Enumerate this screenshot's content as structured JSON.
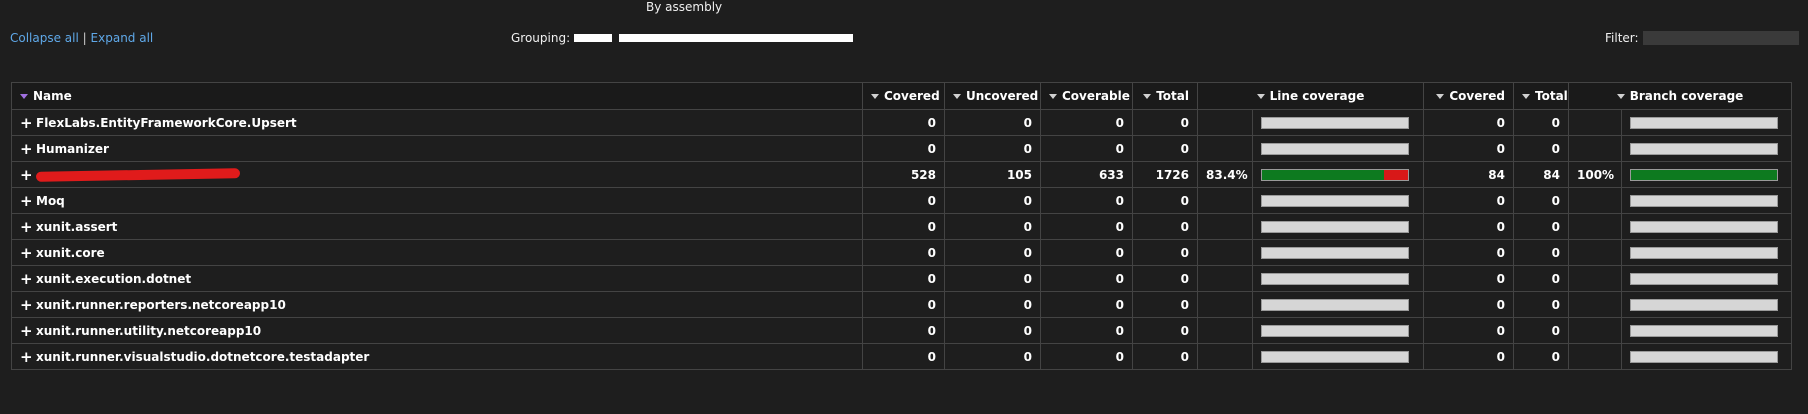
{
  "page_title": "By assembly",
  "toolbar": {
    "collapse_all": "Collapse all",
    "separator": "|",
    "expand_all": "Expand all",
    "grouping_label": "Grouping:",
    "filter_label": "Filter:",
    "filter_value": ""
  },
  "table": {
    "headers": {
      "name": "Name",
      "covered": "Covered",
      "uncovered": "Uncovered",
      "coverable": "Coverable",
      "total": "Total",
      "line_coverage": "Line coverage",
      "branch_covered": "Covered",
      "branch_total": "Total",
      "branch_coverage": "Branch coverage"
    },
    "rows": [
      {
        "name": "FlexLabs.EntityFrameworkCore.Upsert",
        "covered": "0",
        "uncovered": "0",
        "coverable": "0",
        "total": "0",
        "line_pct_text": "",
        "line_pct": null,
        "branch_covered": "0",
        "branch_total": "0",
        "branch_pct_text": "",
        "branch_pct": null
      },
      {
        "name": "Humanizer",
        "covered": "0",
        "uncovered": "0",
        "coverable": "0",
        "total": "0",
        "line_pct_text": "",
        "line_pct": null,
        "branch_covered": "0",
        "branch_total": "0",
        "branch_pct_text": "",
        "branch_pct": null
      },
      {
        "name": "",
        "redacted": true,
        "covered": "528",
        "uncovered": "105",
        "coverable": "633",
        "total": "1726",
        "line_pct_text": "83.4%",
        "line_pct": 83.4,
        "branch_covered": "84",
        "branch_total": "84",
        "branch_pct_text": "100%",
        "branch_pct": 100
      },
      {
        "name": "Moq",
        "covered": "0",
        "uncovered": "0",
        "coverable": "0",
        "total": "0",
        "line_pct_text": "",
        "line_pct": null,
        "branch_covered": "0",
        "branch_total": "0",
        "branch_pct_text": "",
        "branch_pct": null
      },
      {
        "name": "xunit.assert",
        "covered": "0",
        "uncovered": "0",
        "coverable": "0",
        "total": "0",
        "line_pct_text": "",
        "line_pct": null,
        "branch_covered": "0",
        "branch_total": "0",
        "branch_pct_text": "",
        "branch_pct": null
      },
      {
        "name": "xunit.core",
        "covered": "0",
        "uncovered": "0",
        "coverable": "0",
        "total": "0",
        "line_pct_text": "",
        "line_pct": null,
        "branch_covered": "0",
        "branch_total": "0",
        "branch_pct_text": "",
        "branch_pct": null
      },
      {
        "name": "xunit.execution.dotnet",
        "covered": "0",
        "uncovered": "0",
        "coverable": "0",
        "total": "0",
        "line_pct_text": "",
        "line_pct": null,
        "branch_covered": "0",
        "branch_total": "0",
        "branch_pct_text": "",
        "branch_pct": null
      },
      {
        "name": "xunit.runner.reporters.netcoreapp10",
        "covered": "0",
        "uncovered": "0",
        "coverable": "0",
        "total": "0",
        "line_pct_text": "",
        "line_pct": null,
        "branch_covered": "0",
        "branch_total": "0",
        "branch_pct_text": "",
        "branch_pct": null
      },
      {
        "name": "xunit.runner.utility.netcoreapp10",
        "covered": "0",
        "uncovered": "0",
        "coverable": "0",
        "total": "0",
        "line_pct_text": "",
        "line_pct": null,
        "branch_covered": "0",
        "branch_total": "0",
        "branch_pct_text": "",
        "branch_pct": null
      },
      {
        "name": "xunit.runner.visualstudio.dotnetcore.testadapter",
        "covered": "0",
        "uncovered": "0",
        "coverable": "0",
        "total": "0",
        "line_pct_text": "",
        "line_pct": null,
        "branch_covered": "0",
        "branch_total": "0",
        "branch_pct_text": "",
        "branch_pct": null
      }
    ]
  },
  "icons": {
    "expand": "plus-icon",
    "sort": "sort-down-arrow-icon"
  },
  "colors": {
    "background": "#1e1e1e",
    "link": "#5fa8e8",
    "covered": "#0d7a1f",
    "uncovered": "#d81818",
    "empty_bar": "#d6d6d6",
    "active_sort": "#a070e0"
  }
}
